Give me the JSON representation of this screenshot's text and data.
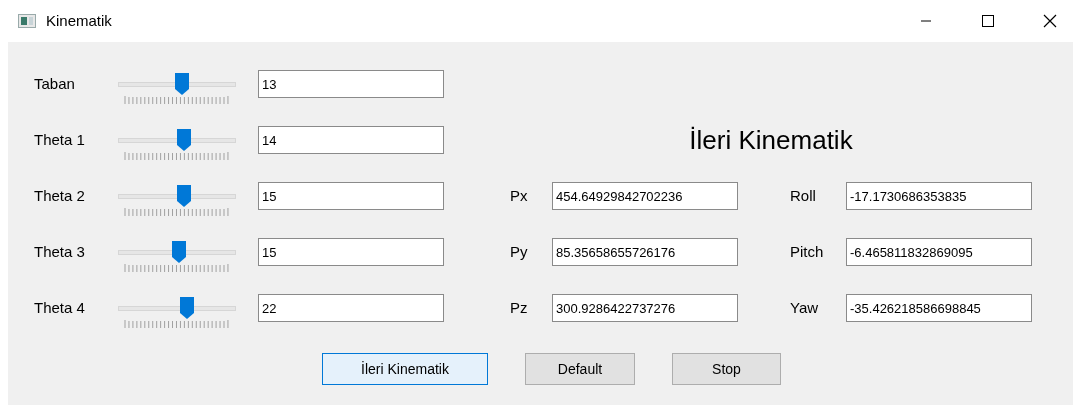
{
  "window": {
    "title": "Kinematik"
  },
  "joints": [
    {
      "label": "Taban",
      "level": 0.55,
      "value": "13"
    },
    {
      "label": "Theta 1",
      "level": 0.57,
      "value": "14"
    },
    {
      "label": "Theta 2",
      "level": 0.57,
      "value": "15"
    },
    {
      "label": "Theta 3",
      "level": 0.52,
      "value": "15"
    },
    {
      "label": "Theta 4",
      "level": 0.6,
      "value": "22"
    }
  ],
  "heading": "İleri Kinematik",
  "results": [
    {
      "label": "Px",
      "value": "454.64929842702236",
      "label_2": "Roll",
      "value_2": "-17.1730686353835"
    },
    {
      "label": "Py",
      "value": "85.35658655726176",
      "label_2": "Pitch",
      "value_2": "-6.465811832869095"
    },
    {
      "label": "Pz",
      "value": "300.9286422737276",
      "label_2": "Yaw",
      "value_2": "-35.426218586698845"
    }
  ],
  "buttons": [
    {
      "label": "İleri Kinematik",
      "focused": true
    },
    {
      "label": "Default",
      "focused": false
    },
    {
      "label": "Stop",
      "focused": false
    }
  ]
}
